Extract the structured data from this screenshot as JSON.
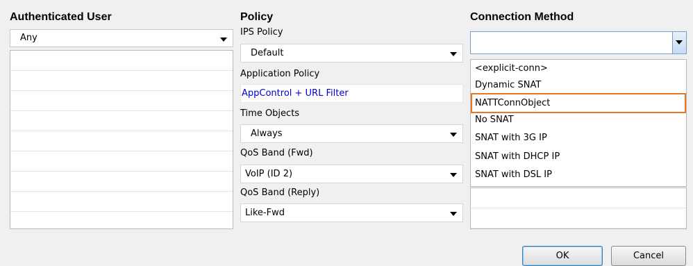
{
  "headers": {
    "authenticated_user": "Authenticated User",
    "policy": "Policy",
    "connection_method": "Connection Method"
  },
  "auth_user": {
    "selected": "Any"
  },
  "policy": {
    "ips_label": "IPS Policy",
    "ips_value": "Default",
    "app_label": "Application Policy",
    "app_value": "AppControl + URL Filter",
    "time_label": "Time Objects",
    "time_value": "Always",
    "qos_fwd_label": "QoS Band (Fwd)",
    "qos_fwd_value": "VoIP (ID 2)",
    "qos_reply_label": "QoS Band (Reply)",
    "qos_reply_value": "Like-Fwd"
  },
  "connection_method": {
    "value": "",
    "options": [
      "<explicit-conn>",
      "Dynamic SNAT",
      "NATTConnObject",
      "No SNAT",
      "SNAT with 3G IP",
      "SNAT with DHCP IP",
      "SNAT with DSL IP"
    ],
    "highlighted": "NATTConnObject"
  },
  "buttons": {
    "ok": "OK",
    "cancel": "Cancel"
  },
  "colors": {
    "highlight_border": "#e87722",
    "link": "#0000cc"
  }
}
